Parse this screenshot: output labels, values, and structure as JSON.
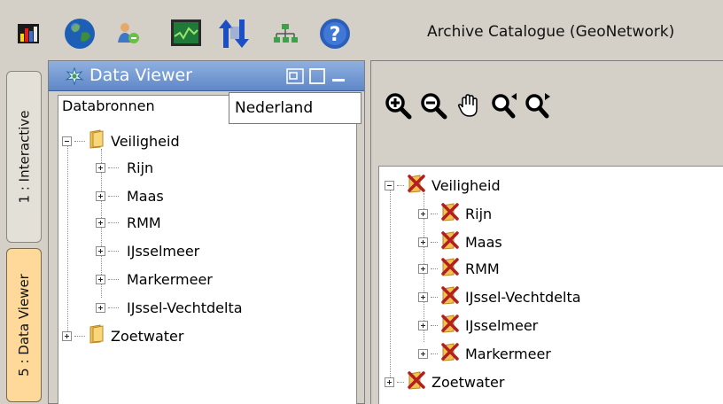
{
  "toolbar": {
    "icons": [
      "chart-icon",
      "globe-icon",
      "user-connect-icon",
      "monitor-icon",
      "transfer-icon",
      "network-icon",
      "help-icon"
    ],
    "archive_label": "Archive Catalogue (GeoNetwork)"
  },
  "tabs": [
    {
      "label": "1 : Interactive",
      "active": false
    },
    {
      "label": "5 : Data Viewer",
      "active": true
    }
  ],
  "data_viewer": {
    "title": "Data Viewer",
    "subtitle": "Databronnen",
    "tree": [
      {
        "label": "Veiligheid",
        "expanded": true,
        "level": 0
      },
      {
        "label": "Rijn",
        "expanded": false,
        "level": 1
      },
      {
        "label": "Maas",
        "expanded": false,
        "level": 1
      },
      {
        "label": "RMM",
        "expanded": false,
        "level": 1
      },
      {
        "label": "IJsselmeer",
        "expanded": false,
        "level": 1
      },
      {
        "label": "Markermeer",
        "expanded": false,
        "level": 1
      },
      {
        "label": "IJssel-Vechtdelta",
        "expanded": false,
        "level": 1
      },
      {
        "label": "Zoetwater",
        "expanded": false,
        "level": 0
      }
    ]
  },
  "map": {
    "tools": [
      "zoom-in-icon",
      "zoom-out-icon",
      "pan-hand-icon",
      "zoom-previous-icon",
      "zoom-next-icon"
    ],
    "location_value": "Nederland",
    "tree": [
      {
        "label": "Veiligheid",
        "expanded": true,
        "level": 0
      },
      {
        "label": "Rijn",
        "expanded": false,
        "level": 1
      },
      {
        "label": "Maas",
        "expanded": false,
        "level": 1
      },
      {
        "label": "RMM",
        "expanded": false,
        "level": 1
      },
      {
        "label": "IJssel-Vechtdelta",
        "expanded": false,
        "level": 1
      },
      {
        "label": "IJsselmeer",
        "expanded": false,
        "level": 1
      },
      {
        "label": "Markermeer",
        "expanded": false,
        "level": 1
      },
      {
        "label": "Zoetwater",
        "expanded": false,
        "level": 0
      }
    ]
  },
  "colors": {
    "accent_header": "#6f95d0",
    "active_tab": "#ffd99a",
    "folder": "#f2c14e",
    "layer_cross": "#b31f1f"
  }
}
